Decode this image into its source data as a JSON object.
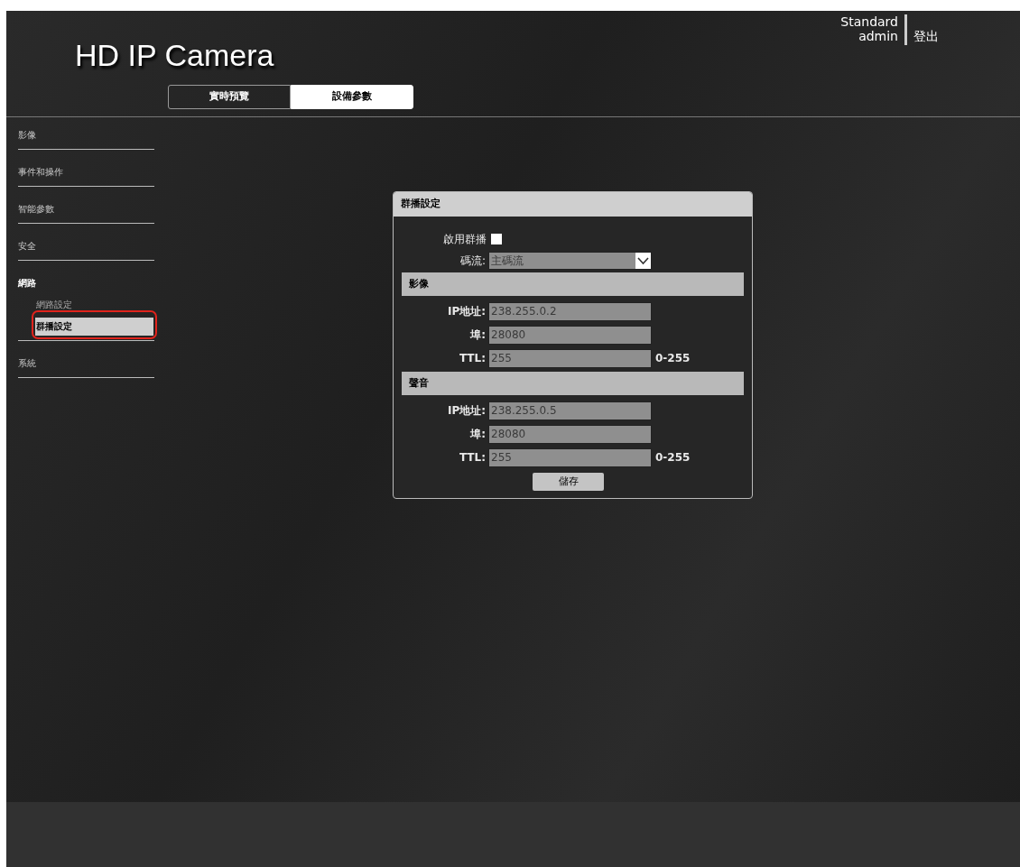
{
  "header": {
    "title": "HD IP Camera",
    "user_role": "Standard",
    "user_name": "admin",
    "logout": "登出"
  },
  "tabs": [
    {
      "label": "實時預覽",
      "selected": false
    },
    {
      "label": "設備參數",
      "selected": true
    }
  ],
  "sidebar": {
    "items": [
      {
        "label": "影像",
        "expanded": false
      },
      {
        "label": "事件和操作",
        "expanded": false
      },
      {
        "label": "智能參數",
        "expanded": false
      },
      {
        "label": "安全",
        "expanded": false
      },
      {
        "label": "網路",
        "expanded": true,
        "children": [
          {
            "label": "網路設定",
            "selected": false,
            "highlighted": false
          },
          {
            "label": "群播設定",
            "selected": true,
            "highlighted": true
          }
        ]
      },
      {
        "label": "系統",
        "expanded": false
      }
    ]
  },
  "panel": {
    "title": "群播設定",
    "enable": {
      "label": "啟用群播",
      "checked": false
    },
    "stream": {
      "label": "碼流:",
      "value": "主碼流",
      "disabled": true
    },
    "sections": [
      {
        "title": "影像",
        "fields": [
          {
            "label": "IP地址:",
            "value": "238.255.0.2",
            "disabled": true
          },
          {
            "label": "埠:",
            "value": "28080",
            "disabled": true
          },
          {
            "label": "TTL:",
            "value": "255",
            "disabled": true,
            "hint": "0-255"
          }
        ]
      },
      {
        "title": "聲音",
        "fields": [
          {
            "label": "IP地址:",
            "value": "238.255.0.5",
            "disabled": true
          },
          {
            "label": "埠:",
            "value": "28080",
            "disabled": true
          },
          {
            "label": "TTL:",
            "value": "255",
            "disabled": true,
            "hint": "0-255"
          }
        ]
      }
    ],
    "save": "儲存"
  }
}
